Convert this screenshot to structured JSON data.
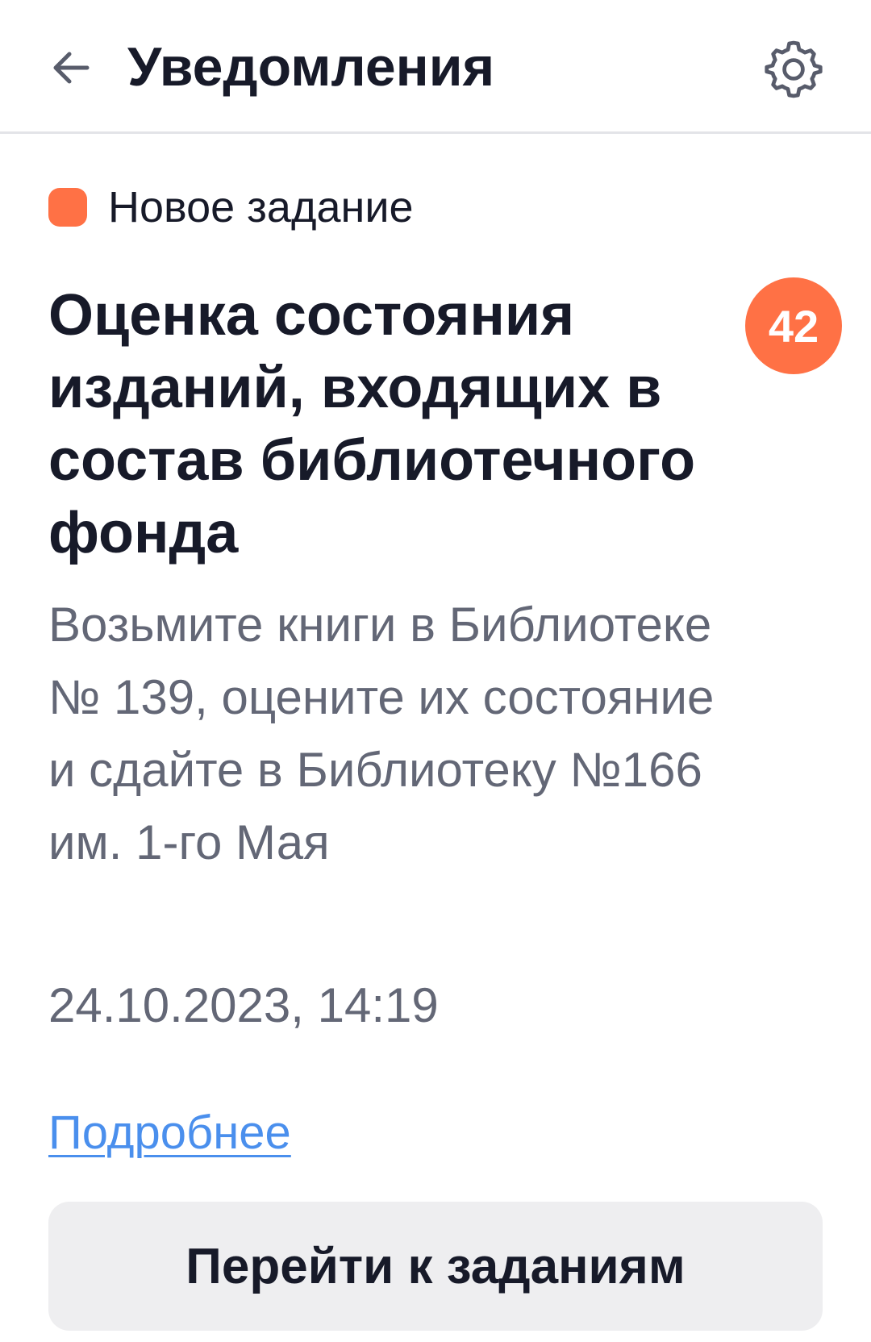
{
  "header": {
    "title": "Уведомления",
    "back_icon": "arrow-left-icon",
    "settings_icon": "gear-icon"
  },
  "notification": {
    "status_label": "Новое задание",
    "status_color": "#ff7145",
    "title": "Оценка состояния изданий, входящих в состав библиотечного фонда",
    "count_badge": "42",
    "description": "Возьмите книги в Библиотеке № 139, оцените их состояние и сдайте в Библиотеку №166 им. 1-го Мая",
    "datetime": "24.10.2023, 14:19",
    "details_link": "Подробнее",
    "link_color": "#4a8fed"
  },
  "actions": {
    "goto_tasks_label": "Перейти к заданиям"
  }
}
